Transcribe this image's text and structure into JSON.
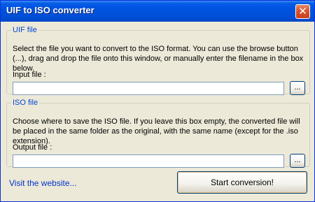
{
  "window": {
    "title": "UIF to ISO converter"
  },
  "uif_group": {
    "legend": "UIF file",
    "description": "Select the file you want to convert to the ISO format. You can use the browse button (...), drag and drop the file onto this window, or manually enter the filename in the box below.",
    "input_label": "Input file :",
    "input_value": "",
    "browse_label": "..."
  },
  "iso_group": {
    "legend": "ISO file",
    "description": "Choose where to save the ISO file. If you leave this box empty, the converted file will be placed in the same folder as the original, with the same name (except for the .iso extension).",
    "output_label": "Output file :",
    "output_value": "",
    "browse_label": "..."
  },
  "footer": {
    "website_link": "Visit the website...",
    "start_button": "Start conversion!"
  },
  "colors": {
    "titlebar": "#0054e3",
    "group_legend": "#0046d5",
    "close_button": "#d9532f",
    "link": "#0033cc"
  },
  "icons": {
    "close": "close-icon"
  }
}
